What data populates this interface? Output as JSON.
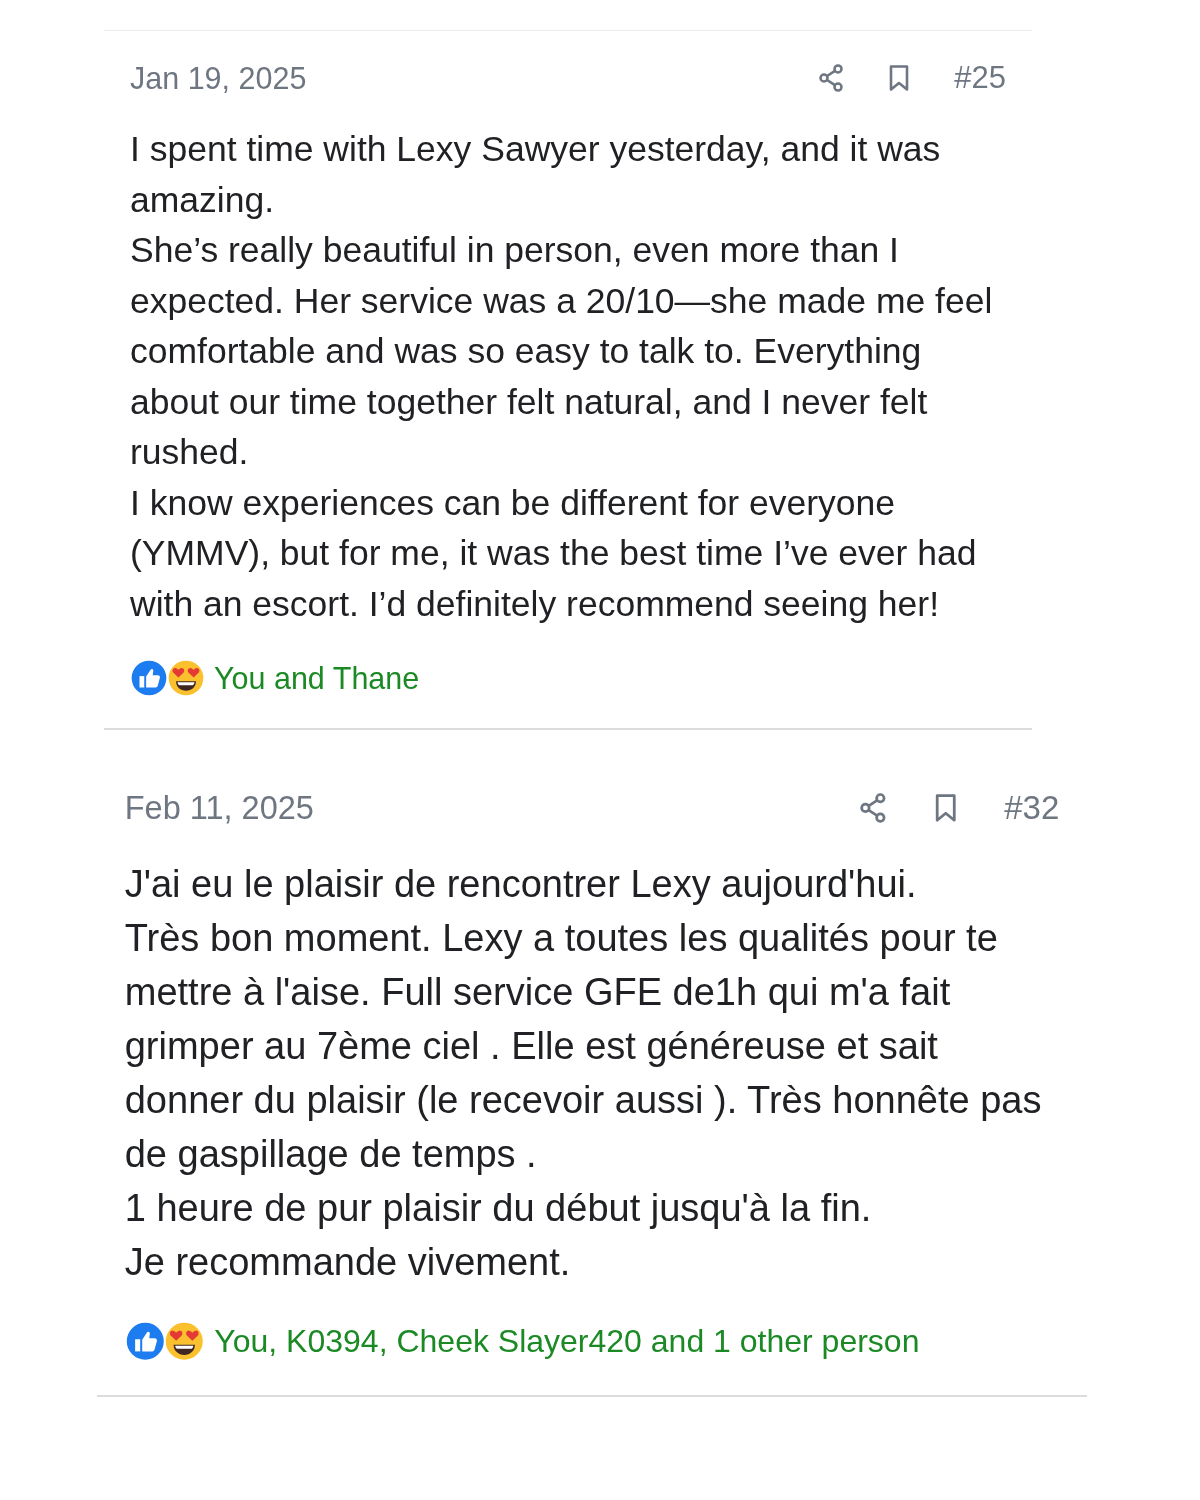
{
  "posts": [
    {
      "date": "Jan 19, 2025",
      "number": "#25",
      "paragraphs": [
        "I spent time with Lexy Sawyer yesterday, and it was amazing.",
        "She’s really beautiful in person, even more than I expected. Her service was a 20/10—she made me feel comfortable and was so easy to talk to. Everything about our time together felt natural, and I never felt rushed.",
        "I know experiences can be different for everyone (YMMV), but for me, it was the best time I’ve ever had with an escort. I’d definitely recommend seeing her!"
      ],
      "reactions": "You and Thane"
    },
    {
      "date": "Feb 11, 2025",
      "number": "#32",
      "paragraphs": [
        "J'ai eu le plaisir de rencontrer Lexy aujourd'hui.",
        "Très bon moment. Lexy a toutes les qualités pour te mettre à l'aise. Full service GFE de1h qui m'a fait grimper au 7ème ciel . Elle est généreuse et sait donner du plaisir (le recevoir aussi ). Très honnête pas de gaspillage de temps .",
        "1 heure de pur plaisir du début jusqu'à la fin.",
        "Je recommande vivement."
      ],
      "reactions": "You, K0394, Cheek Slayer420 and 1 other person"
    }
  ]
}
